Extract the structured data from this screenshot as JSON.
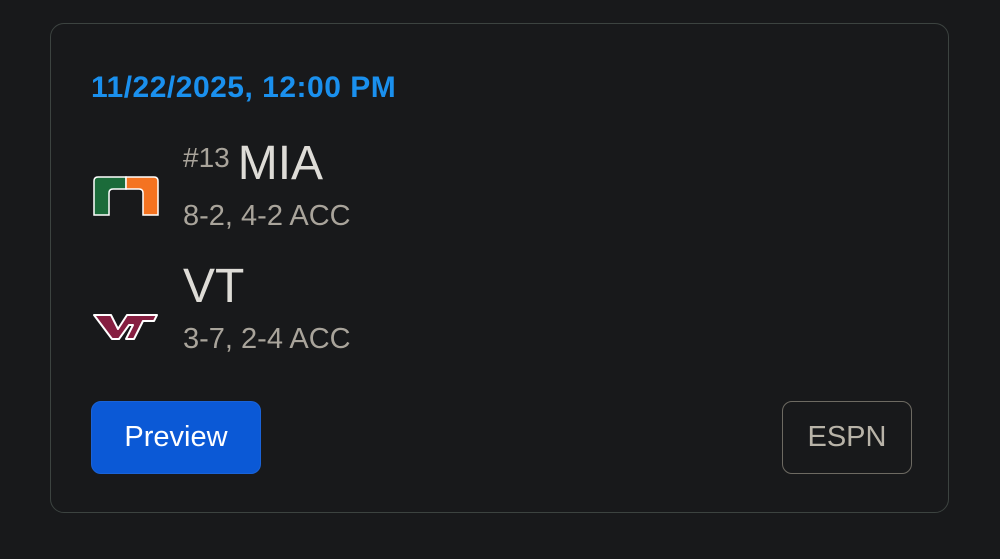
{
  "game": {
    "datetime": "11/22/2025, 12:00 PM",
    "home": {
      "rank": "#13",
      "abbr": "MIA",
      "record": "8-2, 4-2 ACC",
      "logo_icon": "miami-u-logo-icon",
      "colors": {
        "green": "#1b6b3a",
        "orange": "#f47321"
      }
    },
    "away": {
      "abbr": "VT",
      "record": "3-7, 2-4 ACC",
      "logo_icon": "virginia-tech-vt-logo-icon",
      "colors": {
        "maroon": "#861f41",
        "white": "#ffffff"
      }
    }
  },
  "actions": {
    "preview_label": "Preview",
    "espn_label": "ESPN"
  },
  "theme": {
    "accent": "#1a90ee",
    "button_primary": "#0b59d6",
    "background": "#18191b"
  }
}
